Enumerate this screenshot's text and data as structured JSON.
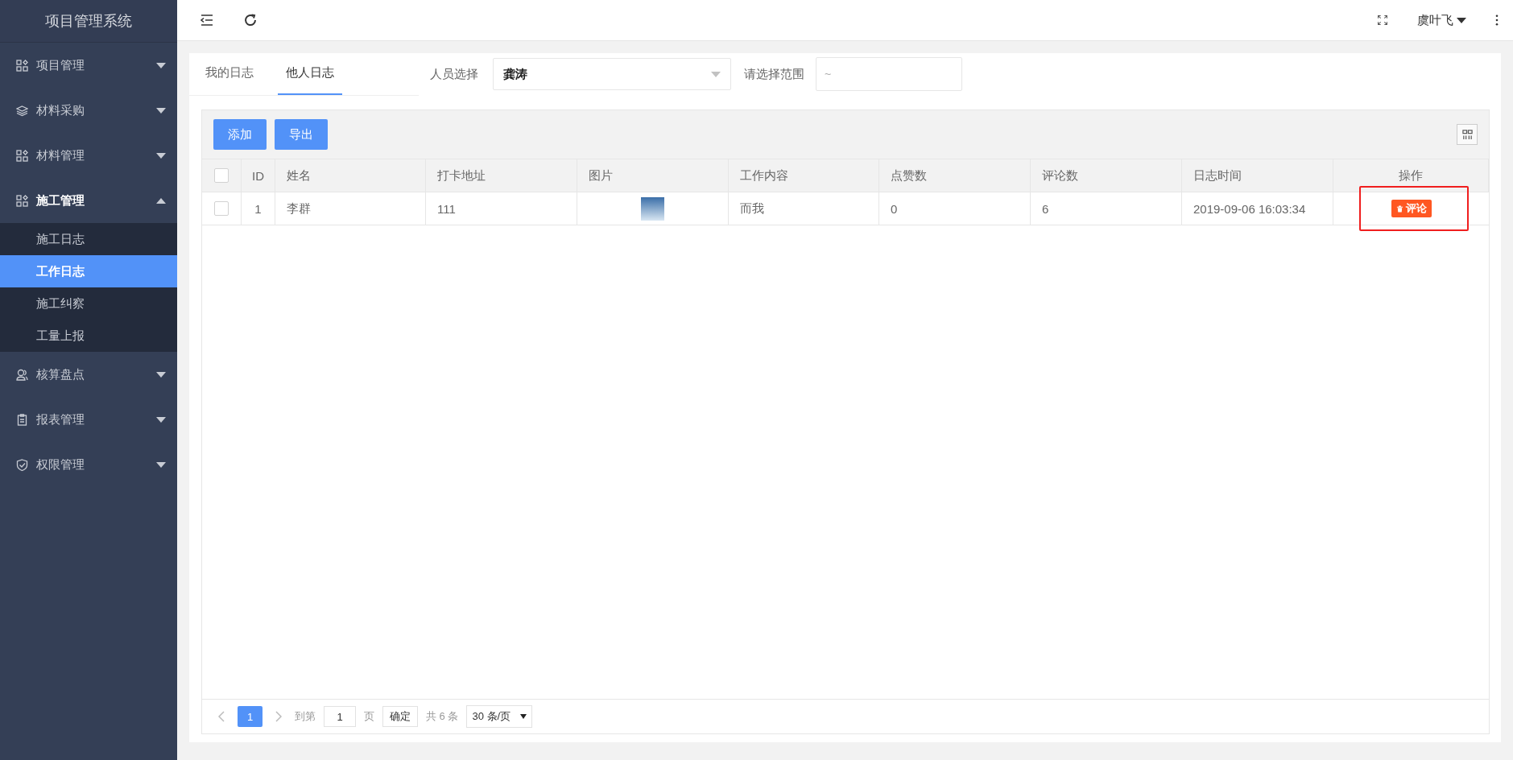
{
  "sidebar": {
    "title": "项目管理系统",
    "items": [
      {
        "label": "项目管理",
        "expanded": false
      },
      {
        "label": "材料采购",
        "expanded": false
      },
      {
        "label": "材料管理",
        "expanded": false
      },
      {
        "label": "施工管理",
        "expanded": true,
        "children": [
          {
            "label": "施工日志",
            "selected": false
          },
          {
            "label": "工作日志",
            "selected": true
          },
          {
            "label": "施工纠察",
            "selected": false
          },
          {
            "label": "工量上报",
            "selected": false
          }
        ]
      },
      {
        "label": "核算盘点",
        "expanded": false
      },
      {
        "label": "报表管理",
        "expanded": false
      },
      {
        "label": "权限管理",
        "expanded": false
      }
    ]
  },
  "topbar": {
    "user": "虞叶飞"
  },
  "tabs": [
    {
      "label": "我的日志",
      "selected": false
    },
    {
      "label": "他人日志",
      "selected": true
    }
  ],
  "filters": {
    "person_label": "人员选择",
    "person_value": "龚涛",
    "range_label": "请选择范围",
    "range_placeholder": "~"
  },
  "toolbar": {
    "buttons": [
      "添加",
      "导出"
    ]
  },
  "table": {
    "select_all_checked": false,
    "columns": [
      "ID",
      "姓名",
      "打卡地址",
      "图片",
      "工作内容",
      "点赞数",
      "评论数",
      "日志时间",
      "操作"
    ],
    "rows": [
      {
        "checked": false,
        "id": "1",
        "name": "李群",
        "address": "111",
        "content": "而我",
        "likes": "0",
        "comments": "6",
        "time": "2019-09-06 16:03:34",
        "action": "评论"
      }
    ]
  },
  "pagination": {
    "pages": [
      {
        "label": "1",
        "selected": true
      }
    ],
    "goto_label": "到第",
    "goto_value": "1",
    "page_unit": "页",
    "confirm": "确定",
    "total": "共 6 条",
    "page_size": "30 条/页"
  }
}
